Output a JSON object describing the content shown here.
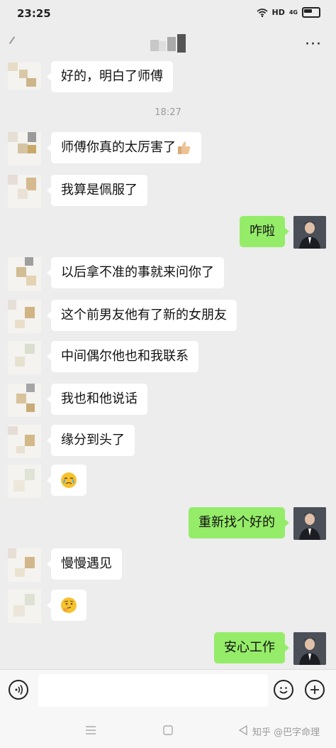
{
  "status_bar": {
    "time": "23:25",
    "signal_text": "HD",
    "network_text": "4G"
  },
  "header": {
    "more_glyph": "···"
  },
  "messages": [
    {
      "side": "in",
      "text": "好的，明白了师傅"
    },
    {
      "side": "in",
      "text": "师傅你真的太厉害了",
      "emoji": "thumbs-up"
    },
    {
      "side": "in",
      "text": "我算是佩服了"
    },
    {
      "side": "out",
      "text": "咋啦"
    },
    {
      "side": "in",
      "text": "以后拿不准的事就来问你了"
    },
    {
      "side": "in",
      "text": "这个前男友他有了新的女朋友"
    },
    {
      "side": "in",
      "text": "中间偶尔他也和我联系"
    },
    {
      "side": "in",
      "text": "我也和他说话"
    },
    {
      "side": "in",
      "text": "缘分到头了"
    },
    {
      "side": "in",
      "text": "",
      "emoji": "crying-face"
    },
    {
      "side": "out",
      "text": "重新找个好的"
    },
    {
      "side": "in",
      "text": "慢慢遇见"
    },
    {
      "side": "in",
      "text": "",
      "emoji": "thinking-face"
    },
    {
      "side": "out",
      "text": "安心工作"
    }
  ],
  "timestamp": "18:27",
  "input_bar": {
    "placeholder": "",
    "icons": [
      "voice-icon",
      "emoji-icon",
      "plus-icon"
    ]
  },
  "system_nav": {
    "icons": [
      "menu-icon",
      "home-icon",
      "back-icon"
    ]
  },
  "watermark": "知乎 @巴字命理",
  "colors": {
    "background": "#ededed",
    "incoming_bubble": "#ffffff",
    "outgoing_bubble": "#95ec69"
  }
}
